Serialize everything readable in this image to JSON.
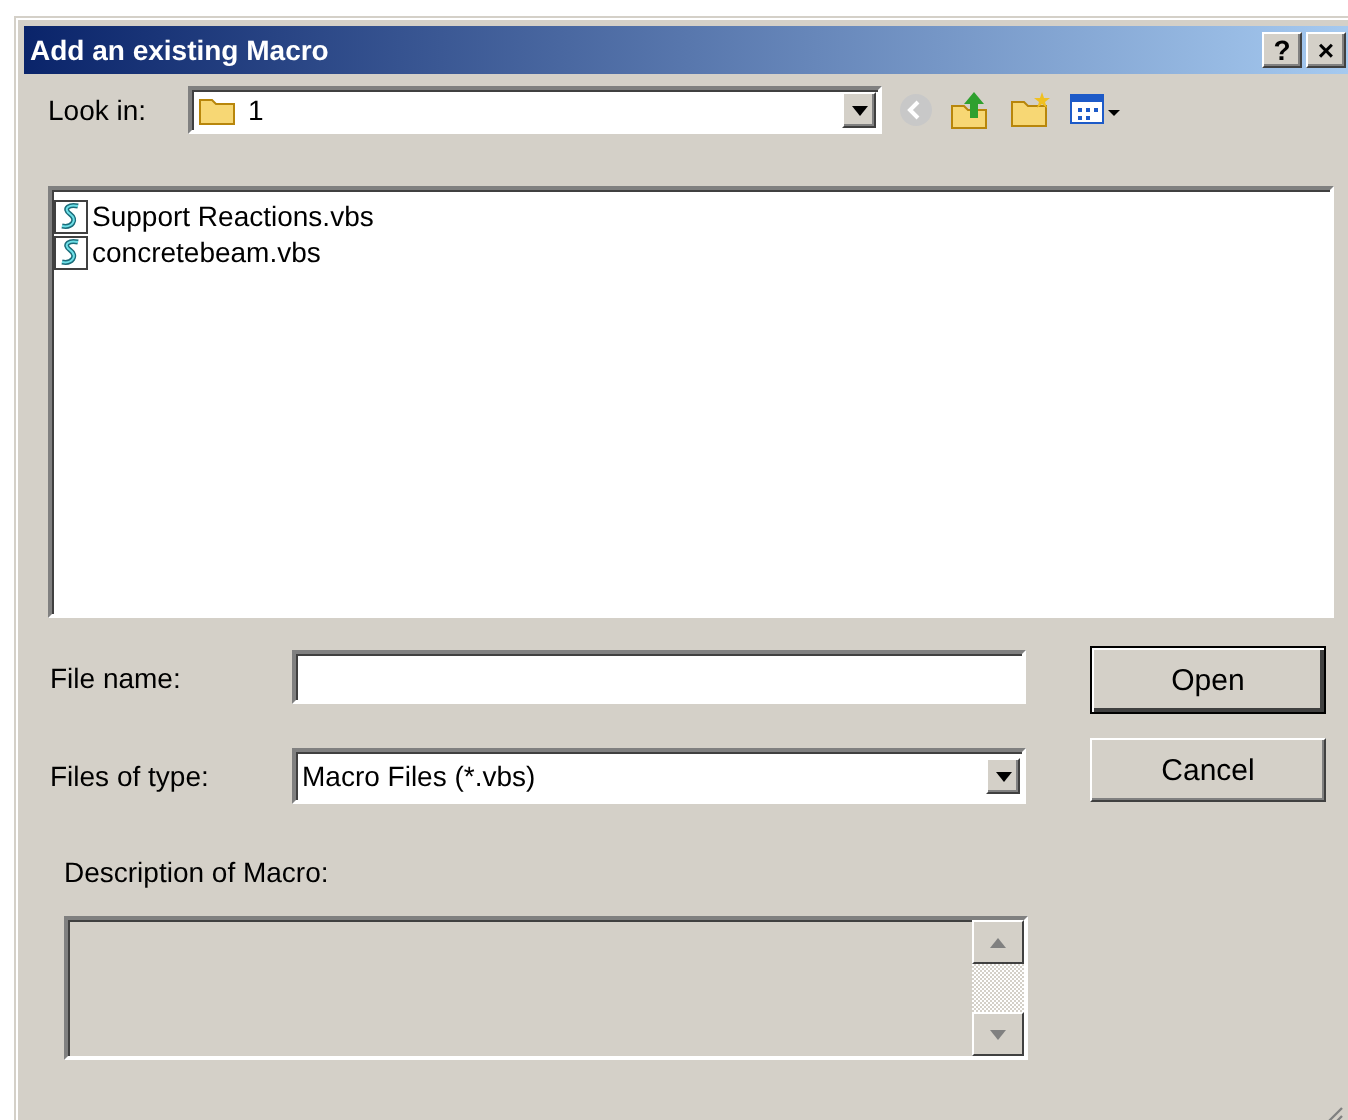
{
  "window": {
    "title": "Add an existing Macro",
    "buttons": [
      "?",
      "×"
    ]
  },
  "look_in": {
    "label": "Look in:",
    "value": "1"
  },
  "files": [
    {
      "name": "Support Reactions.vbs",
      "selected": false
    },
    {
      "name": "concretebeam.vbs",
      "selected": false
    }
  ],
  "file_name": {
    "label": "File name:"
  },
  "files_of_type": {
    "label": "Files of type:",
    "value": "Macro Files (*.vbs)"
  },
  "buttons": [
    {
      "label": "Open",
      "default": true
    },
    {
      "label": "Cancel",
      "default": false
    }
  ],
  "description": {
    "label": "Description of Macro:",
    "disabled": true
  }
}
